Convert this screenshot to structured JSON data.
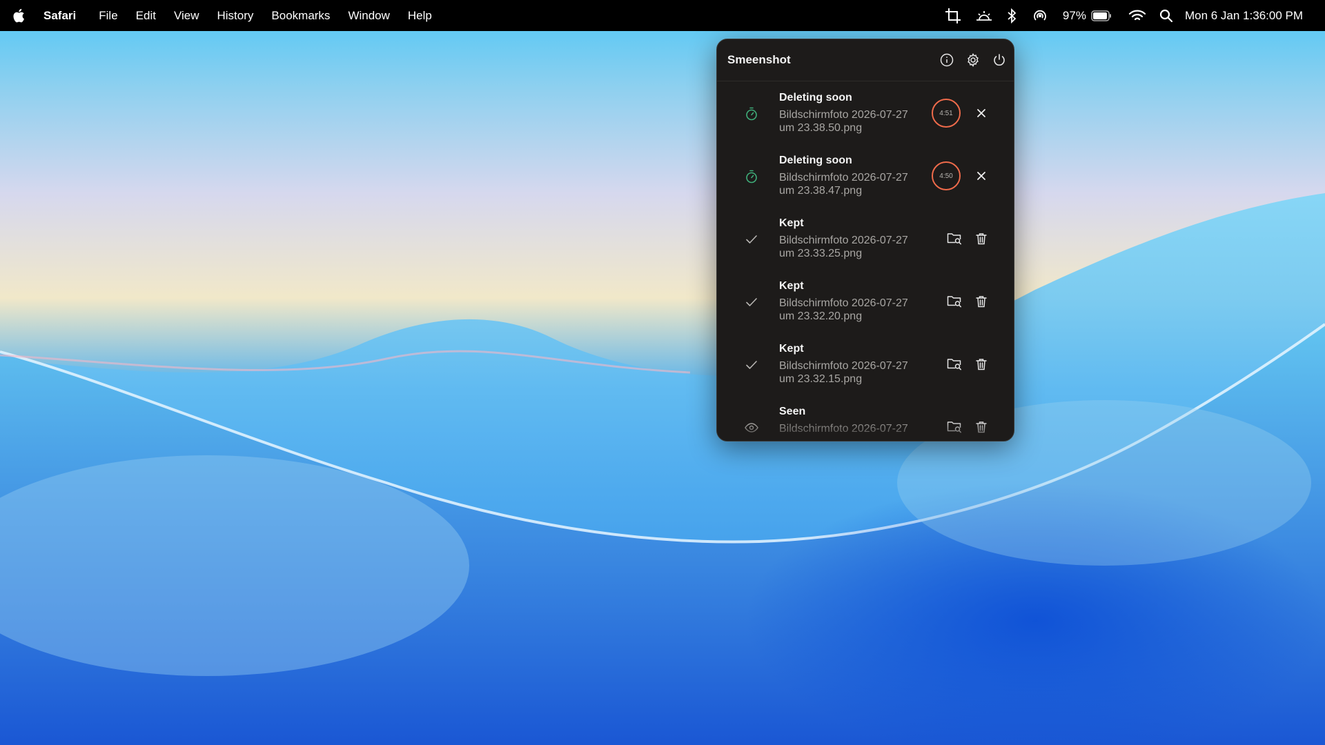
{
  "menubar": {
    "apple_icon": "apple-logo-icon",
    "app_name": "Safari",
    "items": [
      "File",
      "Edit",
      "View",
      "History",
      "Bookmarks",
      "Window",
      "Help"
    ],
    "status": {
      "battery_percent": "97%",
      "datetime": "Mon 6 Jan 1:36:00 PM",
      "icons": [
        "crop-icon",
        "brightness-icon",
        "bluetooth-icon",
        "airdrop-icon",
        "battery-icon",
        "wifi-icon",
        "search-icon"
      ]
    }
  },
  "panel": {
    "title": "Smeenshot",
    "header_icons": [
      "info-icon",
      "gear-icon",
      "power-icon"
    ],
    "accent_green": "#3fae7a",
    "timer_color": "#ef6b4b",
    "items": [
      {
        "status": "Deleting soon",
        "filename": "Bildschirmfoto 2026-07-27 um 23.38.50.png",
        "timer": "4:51",
        "icon": "stopwatch-icon",
        "action": "close-icon"
      },
      {
        "status": "Deleting soon",
        "filename": "Bildschirmfoto 2026-07-27 um 23.38.47.png",
        "timer": "4:50",
        "icon": "stopwatch-icon",
        "action": "close-icon"
      },
      {
        "status": "Kept",
        "filename": "Bildschirmfoto 2026-07-27 um 23.33.25.png",
        "icon": "checkmark-icon",
        "actions": [
          "folder-search-icon",
          "trash-icon"
        ]
      },
      {
        "status": "Kept",
        "filename": "Bildschirmfoto 2026-07-27 um 23.32.20.png",
        "icon": "checkmark-icon",
        "actions": [
          "folder-search-icon",
          "trash-icon"
        ]
      },
      {
        "status": "Kept",
        "filename": "Bildschirmfoto 2026-07-27 um 23.32.15.png",
        "icon": "checkmark-icon",
        "actions": [
          "folder-search-icon",
          "trash-icon"
        ]
      },
      {
        "status": "Seen",
        "filename": "Bildschirmfoto 2026-07-27",
        "icon": "eye-icon",
        "actions": [
          "folder-search-icon",
          "trash-icon"
        ]
      }
    ]
  }
}
